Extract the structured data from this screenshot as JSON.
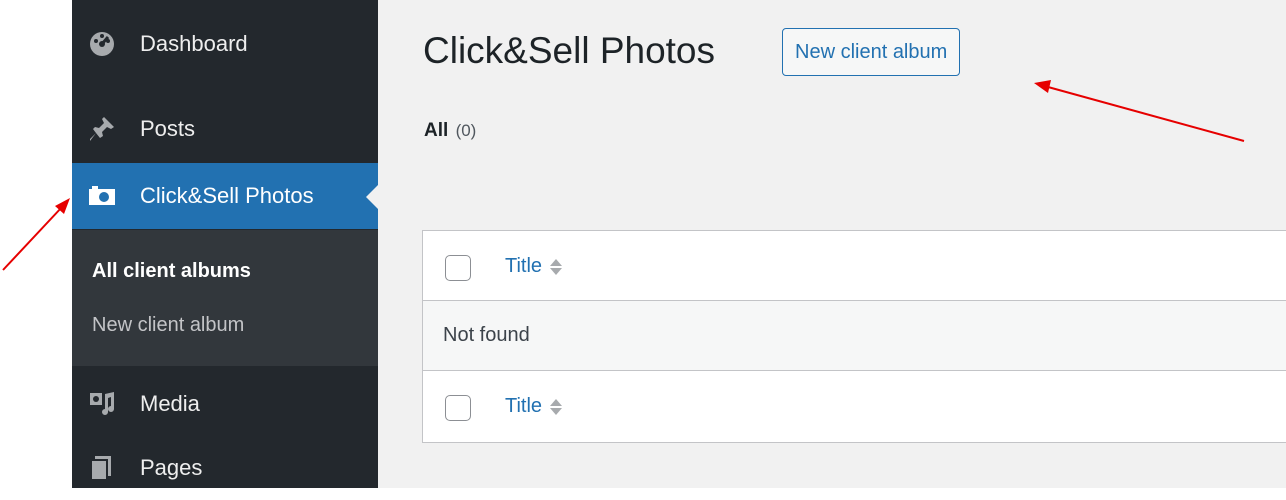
{
  "sidebar": {
    "items": [
      {
        "label": "Dashboard",
        "icon": "dashboard-icon"
      },
      {
        "label": "Posts",
        "icon": "pushpin-icon"
      },
      {
        "label": "Click&Sell Photos",
        "icon": "camera-icon",
        "current": true
      },
      {
        "label": "Media",
        "icon": "media-icon"
      },
      {
        "label": "Pages",
        "icon": "pages-icon"
      }
    ],
    "submenu": [
      {
        "label": "All client albums",
        "current": true
      },
      {
        "label": "New client album"
      }
    ]
  },
  "main": {
    "title": "Click&Sell Photos",
    "add_button": "New client album",
    "filter": {
      "label": "All",
      "count": "(0)"
    },
    "table": {
      "column_title": "Title",
      "empty_message": "Not found"
    }
  },
  "colors": {
    "sidebar_bg": "#23282d",
    "submenu_bg": "#32373c",
    "accent": "#2271b1",
    "annotation_arrow": "#e60000"
  }
}
